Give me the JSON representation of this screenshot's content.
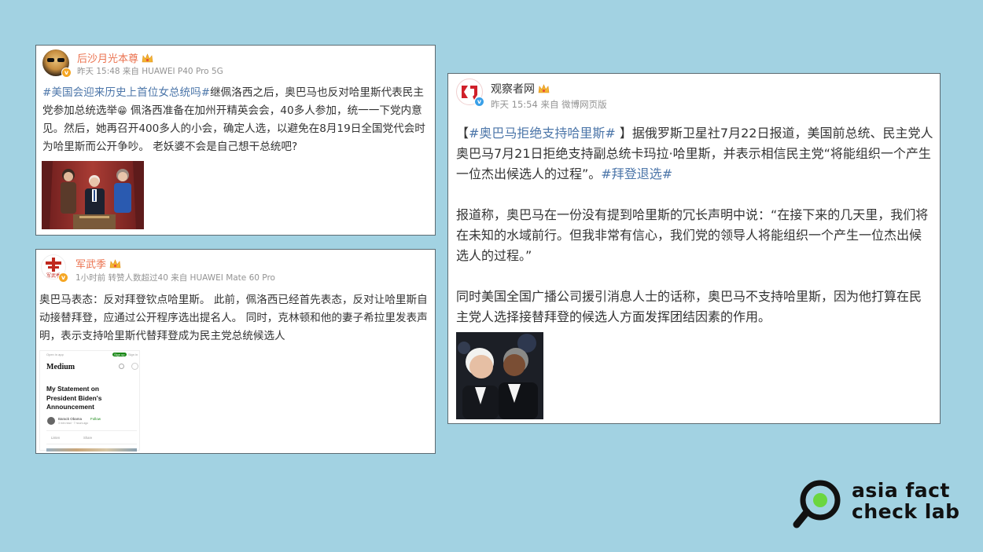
{
  "post1": {
    "username": "后沙月光本尊",
    "meta": "昨天 15:48 来自 HUAWEI P40 Pro 5G",
    "hashtag": "#美国会迎来历史上首位女总统吗#",
    "body_before_emoji": "继佩洛西之后，奥巴马也反对哈里斯代表民主党参加总统选举",
    "emoji": "😁",
    "body_after_emoji": " 佩洛西准备在加州开精英会会，40多人参加，统一一下党内意见。然后，她再召开400多人的小会，确定人选，以避免在8月19日全国党代会时为哈里斯而公开争吵。 老妖婆不会是自己想干总统吧?"
  },
  "post2": {
    "username": "军武季",
    "avatar_text": "军武季",
    "meta": "1小时前 转赞人数超过40 来自 HUAWEI Mate 60 Pro",
    "body": "奥巴马表态：反对拜登钦点哈里斯。 此前，佩洛西已经首先表态，反对让哈里斯自动接替拜登，应通过公开程序选出提名人。 同时，克林顿和他的妻子希拉里发表声明，表示支持哈里斯代替拜登成为民主党总统候选人",
    "screenshot": {
      "top_left": "Open in app",
      "signup": "Sign up",
      "signin": "Sign in",
      "brand": "Medium",
      "title": "My Statement on President Biden's Announcement",
      "author": "Barack Obama",
      "follow": "Follow",
      "read_time": "3 min read · 7 hours ago",
      "listen": "Listen",
      "share": "Share"
    }
  },
  "post3": {
    "username": "观察者网",
    "meta": "昨天 15:54 来自 微博网页版",
    "p1_open": "【",
    "p1_hashtag": "#奥巴马拒绝支持哈里斯#",
    "p1_body": " 】据俄罗斯卫星社7月22日报道，美国前总统、民主党人奥巴马7月21日拒绝支持副总统卡玛拉·哈里斯，并表示相信民主党“将能组织一个产生一位杰出候选人的过程”。",
    "p1_tag2": "#拜登退选#",
    "p2": "报道称，奥巴马在一份没有提到哈里斯的冗长声明中说：“在接下来的几天里，我们将在未知的水域前行。但我非常有信心，我们党的领导人将能组织一个产生一位杰出候选人的过程。”",
    "p3": "同时美国全国广播公司援引消息人士的话称，奥巴马不支持哈里斯，因为他打算在民主党人选择接替拜登的候选人方面发挥团结因素的作用。"
  },
  "logo": {
    "line1": "asia fact",
    "line2": "check lab"
  },
  "colors": {
    "background": "#a2d2e2",
    "username": "#eb7350",
    "hashtag": "#4c76a9",
    "meta": "#939393",
    "logo": "#111111",
    "logo_accent": "#6bd63f"
  }
}
